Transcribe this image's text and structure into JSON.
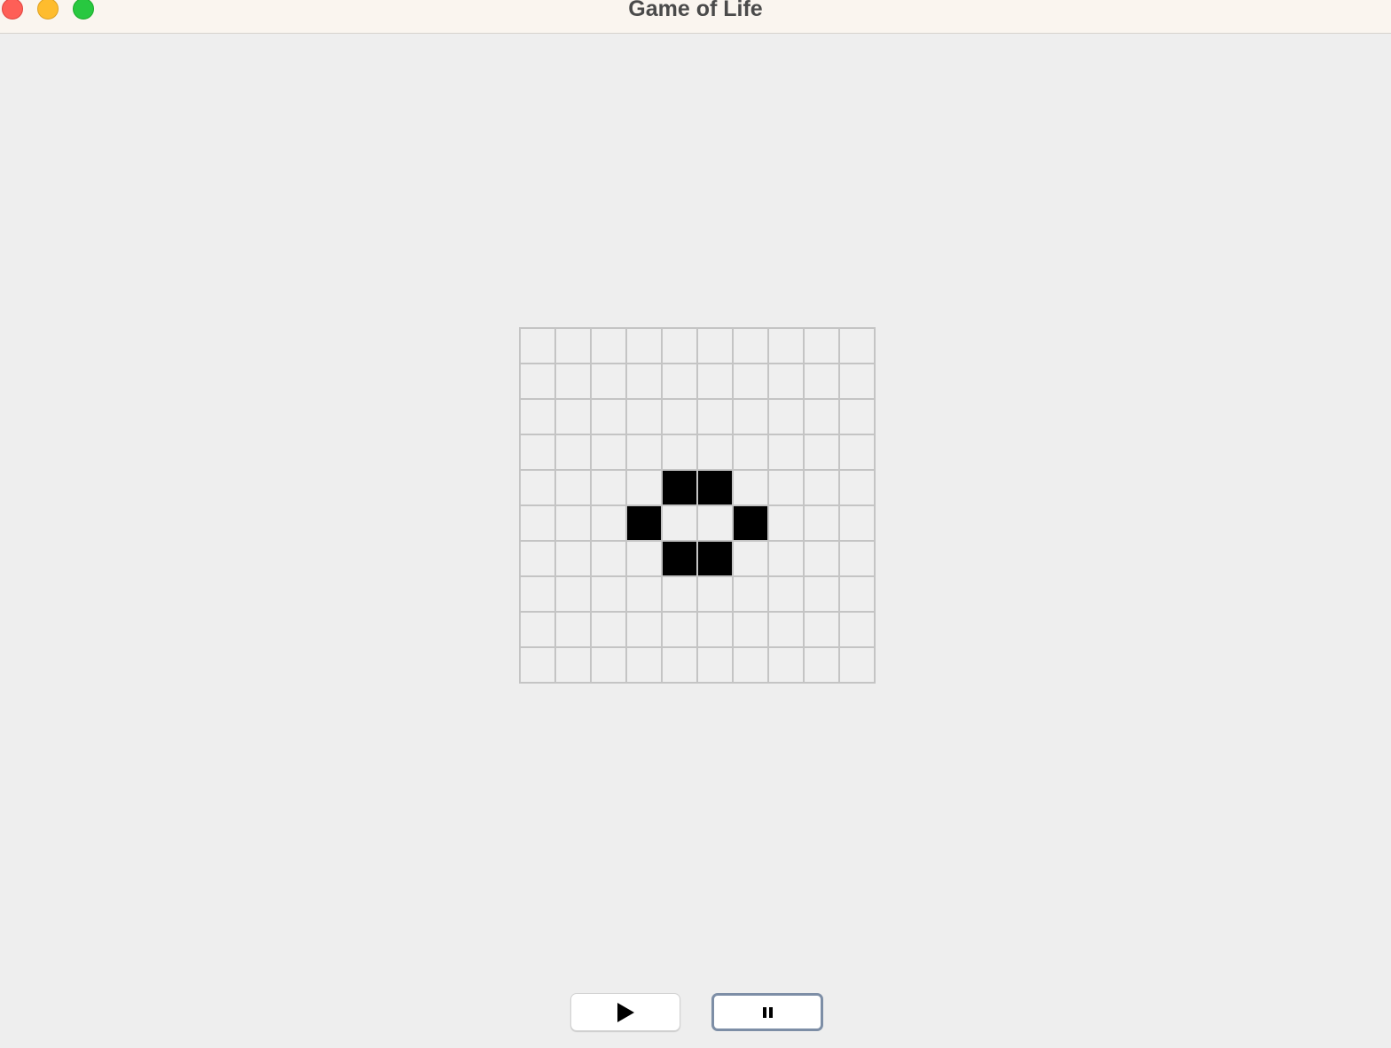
{
  "window": {
    "title": "Game of Life",
    "controls": [
      "close",
      "minimize",
      "zoom"
    ]
  },
  "board": {
    "rows": 10,
    "cols": 10,
    "cells": [
      [
        0,
        0,
        0,
        0,
        0,
        0,
        0,
        0,
        0,
        0
      ],
      [
        0,
        0,
        0,
        0,
        0,
        0,
        0,
        0,
        0,
        0
      ],
      [
        0,
        0,
        0,
        0,
        0,
        0,
        0,
        0,
        0,
        0
      ],
      [
        0,
        0,
        0,
        0,
        0,
        0,
        0,
        0,
        0,
        0
      ],
      [
        0,
        0,
        0,
        0,
        1,
        1,
        0,
        0,
        0,
        0
      ],
      [
        0,
        0,
        0,
        1,
        0,
        0,
        1,
        0,
        0,
        0
      ],
      [
        0,
        0,
        0,
        0,
        1,
        1,
        0,
        0,
        0,
        0
      ],
      [
        0,
        0,
        0,
        0,
        0,
        0,
        0,
        0,
        0,
        0
      ],
      [
        0,
        0,
        0,
        0,
        0,
        0,
        0,
        0,
        0,
        0
      ],
      [
        0,
        0,
        0,
        0,
        0,
        0,
        0,
        0,
        0,
        0
      ]
    ],
    "alive_color": "#000000",
    "dead_color": "#efefef",
    "grid_color": "#c4c4c4"
  },
  "controls": {
    "play": {
      "icon": "play-icon"
    },
    "pause": {
      "icon": "pause-icon",
      "focused": true
    }
  }
}
